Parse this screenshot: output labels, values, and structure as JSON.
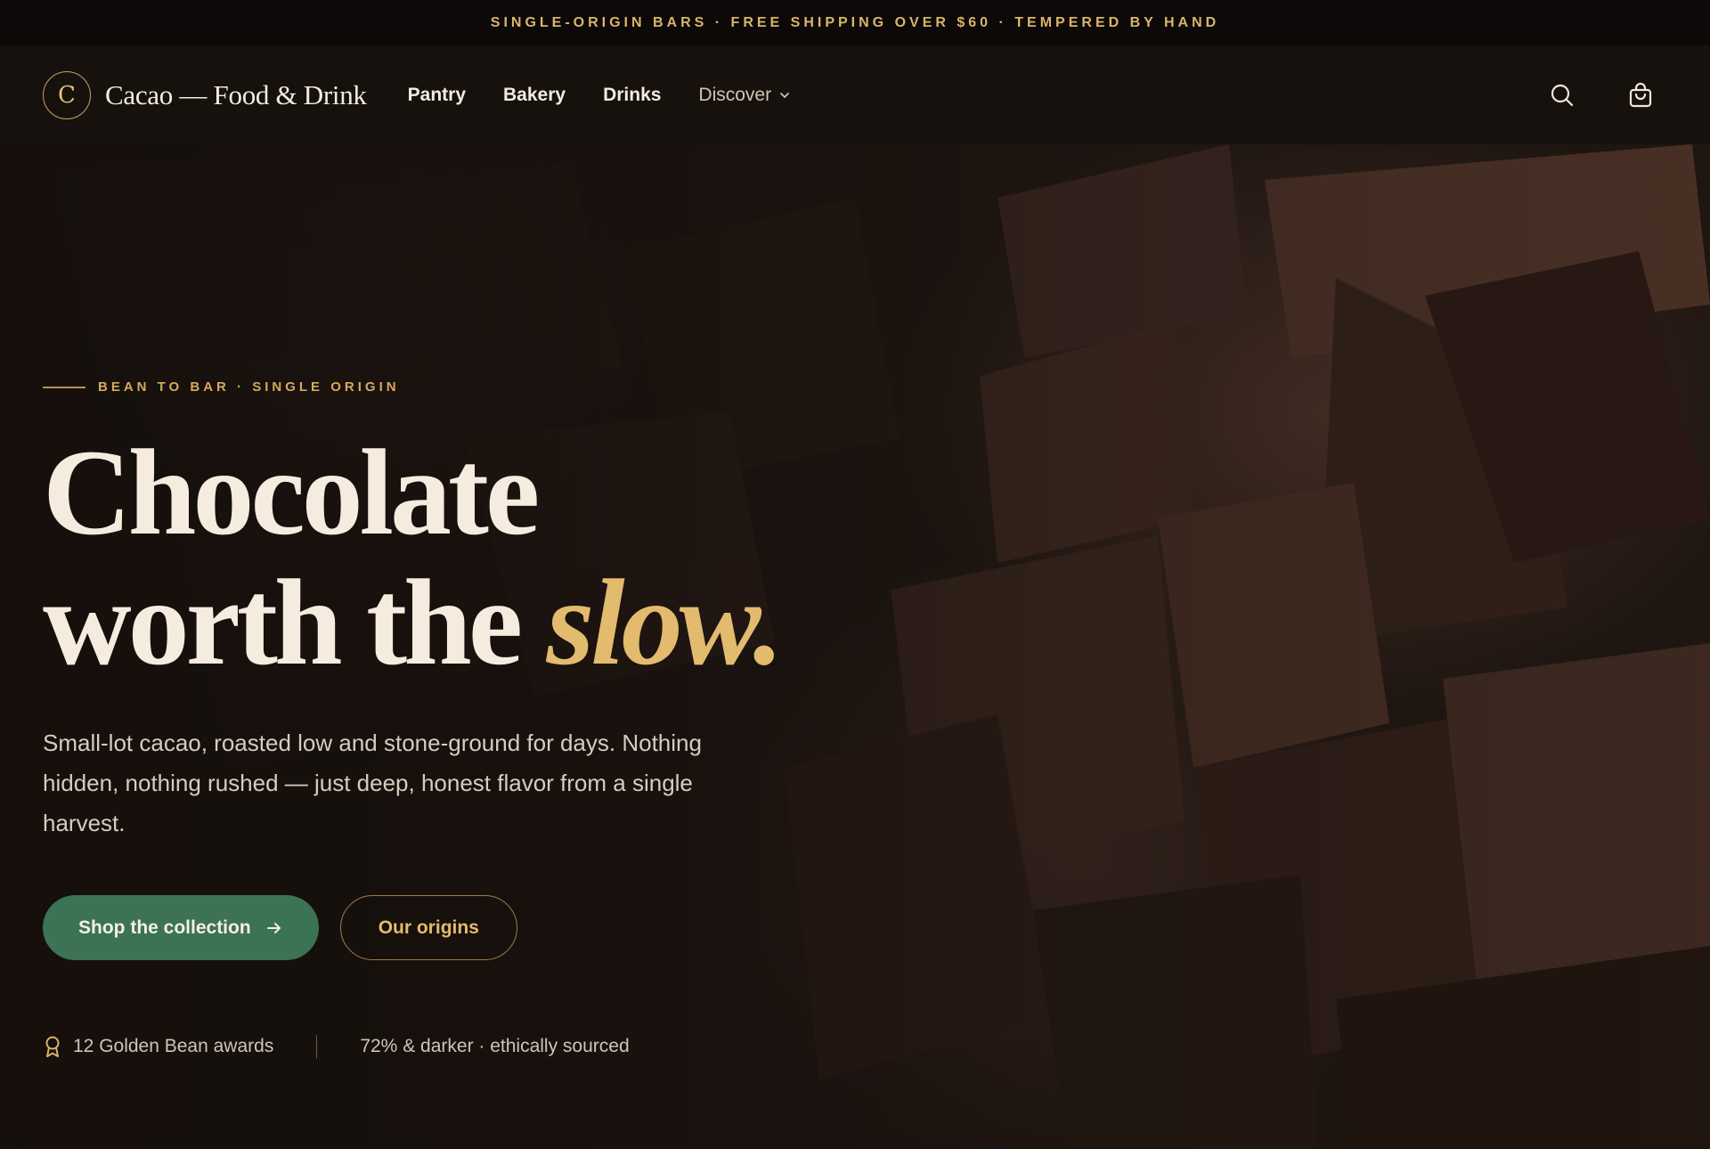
{
  "announcement": "SINGLE-ORIGIN BARS · FREE SHIPPING OVER $60 · TEMPERED BY HAND",
  "header": {
    "brand_mark": "C",
    "brand_name": "Cacao — Food & Drink",
    "nav": [
      "Pantry",
      "Bakery",
      "Drinks"
    ],
    "discover_label": "Discover",
    "icons": [
      "search-icon",
      "bag-icon"
    ]
  },
  "hero": {
    "eyebrow": "BEAN TO BAR · SINGLE ORIGIN",
    "headline_line1": "Chocolate",
    "headline_line2": "worth the ",
    "headline_accent": "slow.",
    "lede": "Small-lot cacao, roasted low and stone-ground for days. Nothing hidden, nothing rushed — just deep, honest flavor from a single harvest.",
    "primary_cta": "Shop the collection",
    "secondary_cta": "Our origins",
    "badge_awards": "12 Golden Bean awards",
    "badge_sourcing": "72% & darker · ethically sourced"
  },
  "colors": {
    "accent_gold": "#d9b46a",
    "primary_green": "#3c7354",
    "background": "#140f0c"
  }
}
